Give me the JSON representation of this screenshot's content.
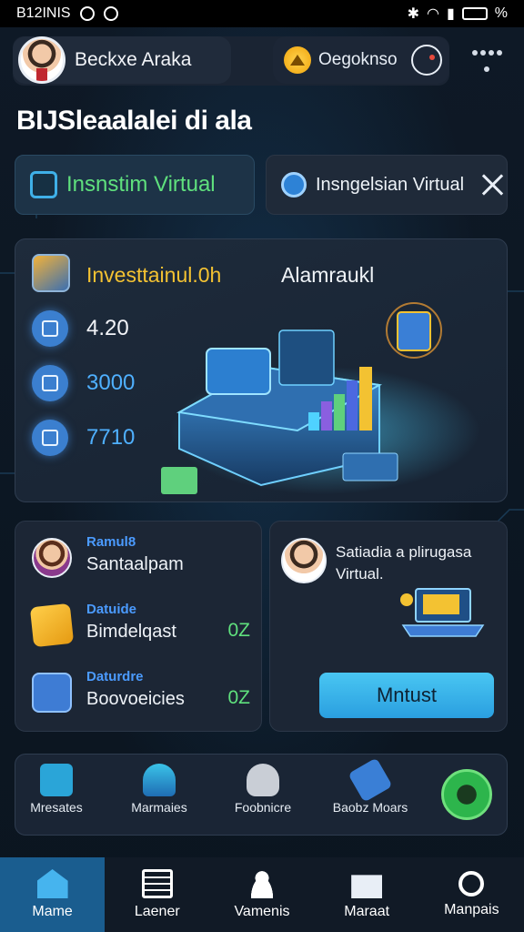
{
  "status_bar": {
    "time_label": "B12INIS",
    "battery": "%"
  },
  "header": {
    "profile_name": "Beckxe Araka",
    "coin_label": "Oegoknso"
  },
  "page_title": "BIJSleaalalei di ala",
  "virtual_buttons": [
    {
      "label": "Insnstim Virtual",
      "icon": "monitor-icon"
    },
    {
      "label": "Insngelsian Virtual",
      "icon": "globe-icon"
    }
  ],
  "invest_panel": {
    "title": "Investtainul.0h",
    "subtitle": "Alamraukl",
    "stats": [
      {
        "value": "4.20",
        "icon": "calculator-icon"
      },
      {
        "value": "3000",
        "icon": "refresh-icon"
      },
      {
        "value": "7710",
        "icon": "cycle-icon"
      }
    ]
  },
  "list_panel": {
    "items": [
      {
        "kicker": "Ramul8",
        "text": "Santaalpam",
        "value": "",
        "icon": "avatar"
      },
      {
        "kicker": "Datuide",
        "text": "Bimdelqast",
        "value": "0Z",
        "icon": "cube-icon"
      },
      {
        "kicker": "Daturdre",
        "text": "Boovoeicies",
        "value": "0Z",
        "icon": "card-icon"
      }
    ]
  },
  "promo_panel": {
    "text": "Satiadia a plirugasa Virtual.",
    "button_label": "Mntust"
  },
  "shortcuts": [
    {
      "label": "Mresates",
      "icon": "message-icon"
    },
    {
      "label": "Marmaies",
      "icon": "materials-icon"
    },
    {
      "label": "Foobnicre",
      "icon": "folder-icon"
    },
    {
      "label": "Baobz Moars",
      "icon": "banner-icon"
    }
  ],
  "bottom_nav": [
    {
      "label": "Mame",
      "icon": "home-icon",
      "active": true
    },
    {
      "label": "Laener",
      "icon": "list-icon",
      "active": false
    },
    {
      "label": "Vamenis",
      "icon": "person-icon",
      "active": false
    },
    {
      "label": "Maraat",
      "icon": "mail-icon",
      "active": false
    },
    {
      "label": "Manpais",
      "icon": "search-icon",
      "active": false
    }
  ],
  "colors": {
    "background": "#0d1724",
    "accent_blue": "#2a9fe0",
    "accent_green": "#5fe07d",
    "accent_gold": "#f3c232"
  }
}
